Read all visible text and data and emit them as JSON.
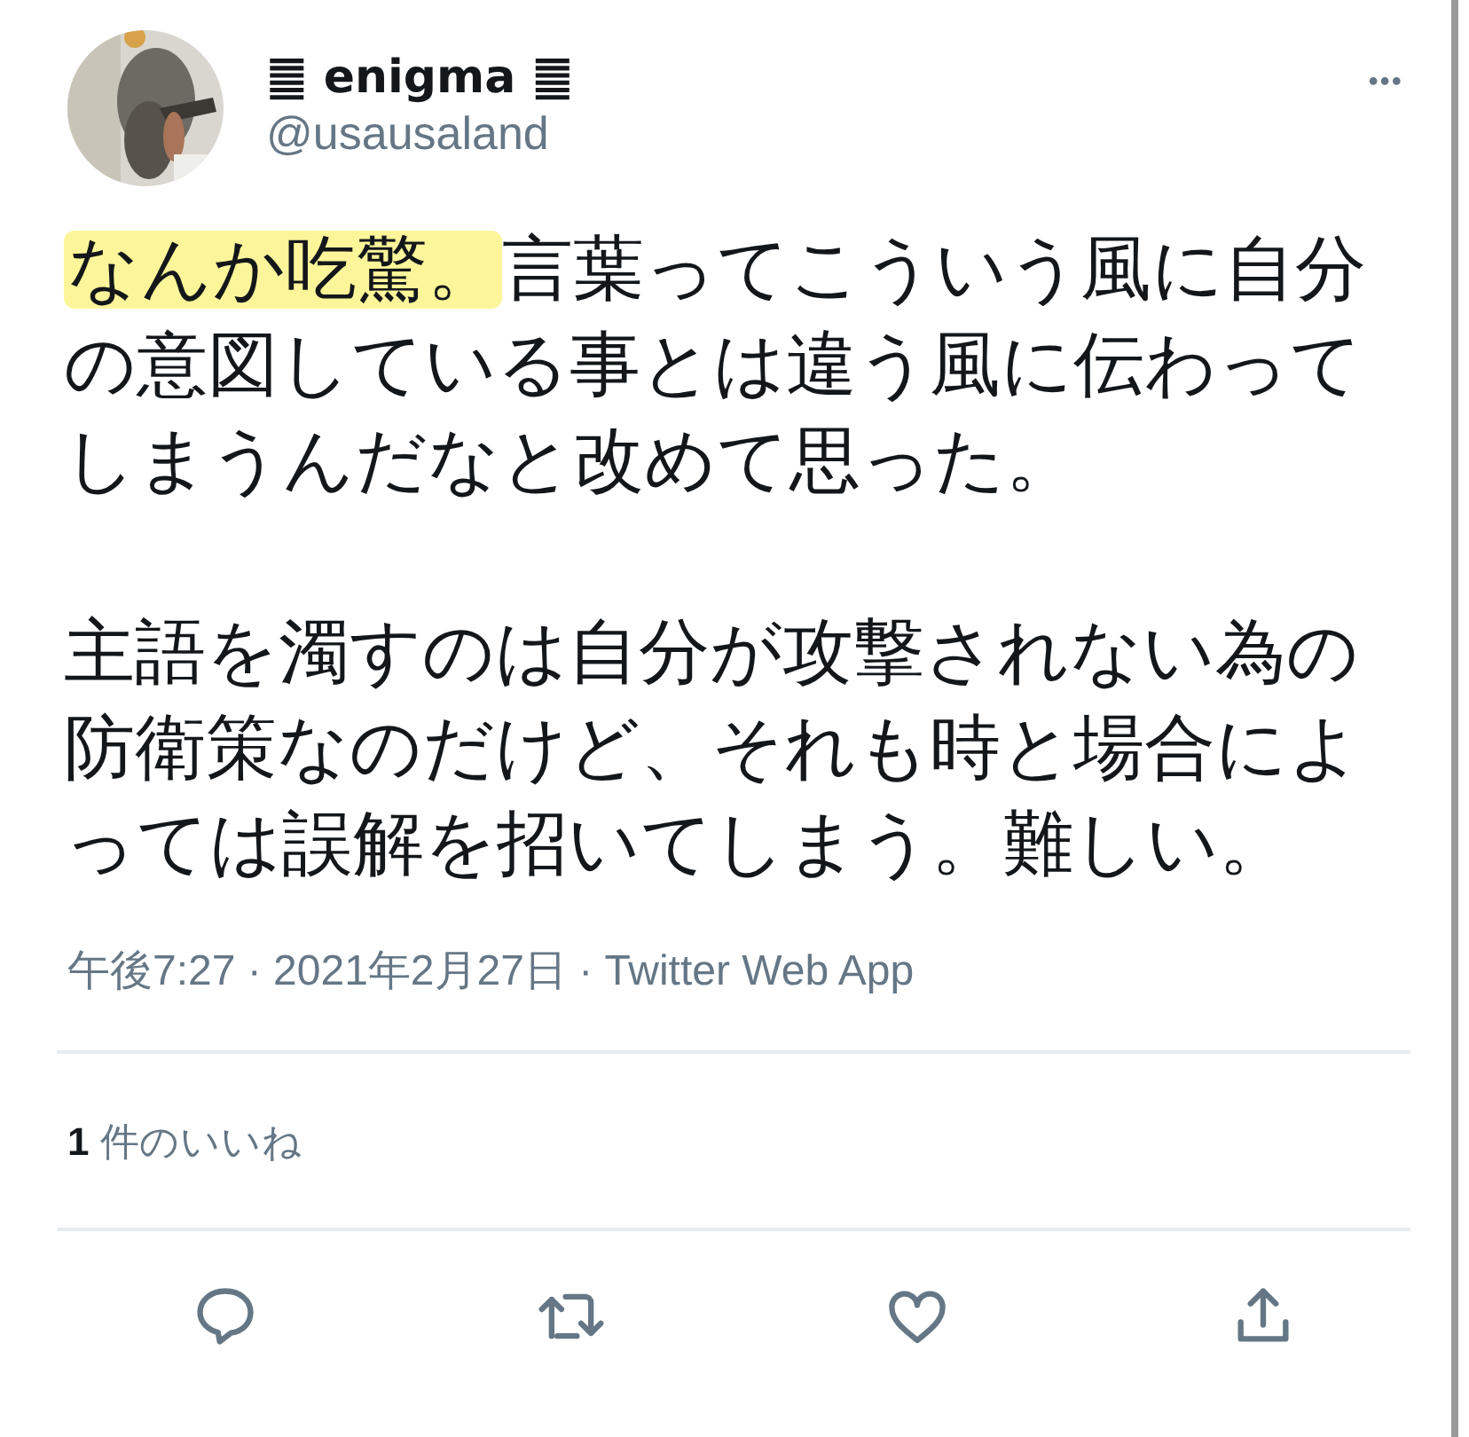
{
  "author": {
    "name": "䷀ enigma ䷀",
    "handle": "@usausaland",
    "more": "•••"
  },
  "tweet": {
    "paragraphs": [
      {
        "highlight": "なんか吃驚。",
        "text": "言葉ってこういう風に自分の意図している事とは違う風に伝わってしまうんだなと改めて思った。"
      },
      {
        "text": "主語を濁すのは自分が攻撃されない為の防衛策なのだけど、それも時と場合によっては誤解を招いてしまう。難しい。"
      }
    ]
  },
  "meta": "午後7:27 · 2021年2月27日 · Twitter Web App",
  "likes": {
    "count": "1",
    "label": "件のいいね"
  },
  "actions": [
    {
      "kind": "reply"
    },
    {
      "kind": "retweet"
    },
    {
      "kind": "like"
    },
    {
      "kind": "share"
    }
  ]
}
